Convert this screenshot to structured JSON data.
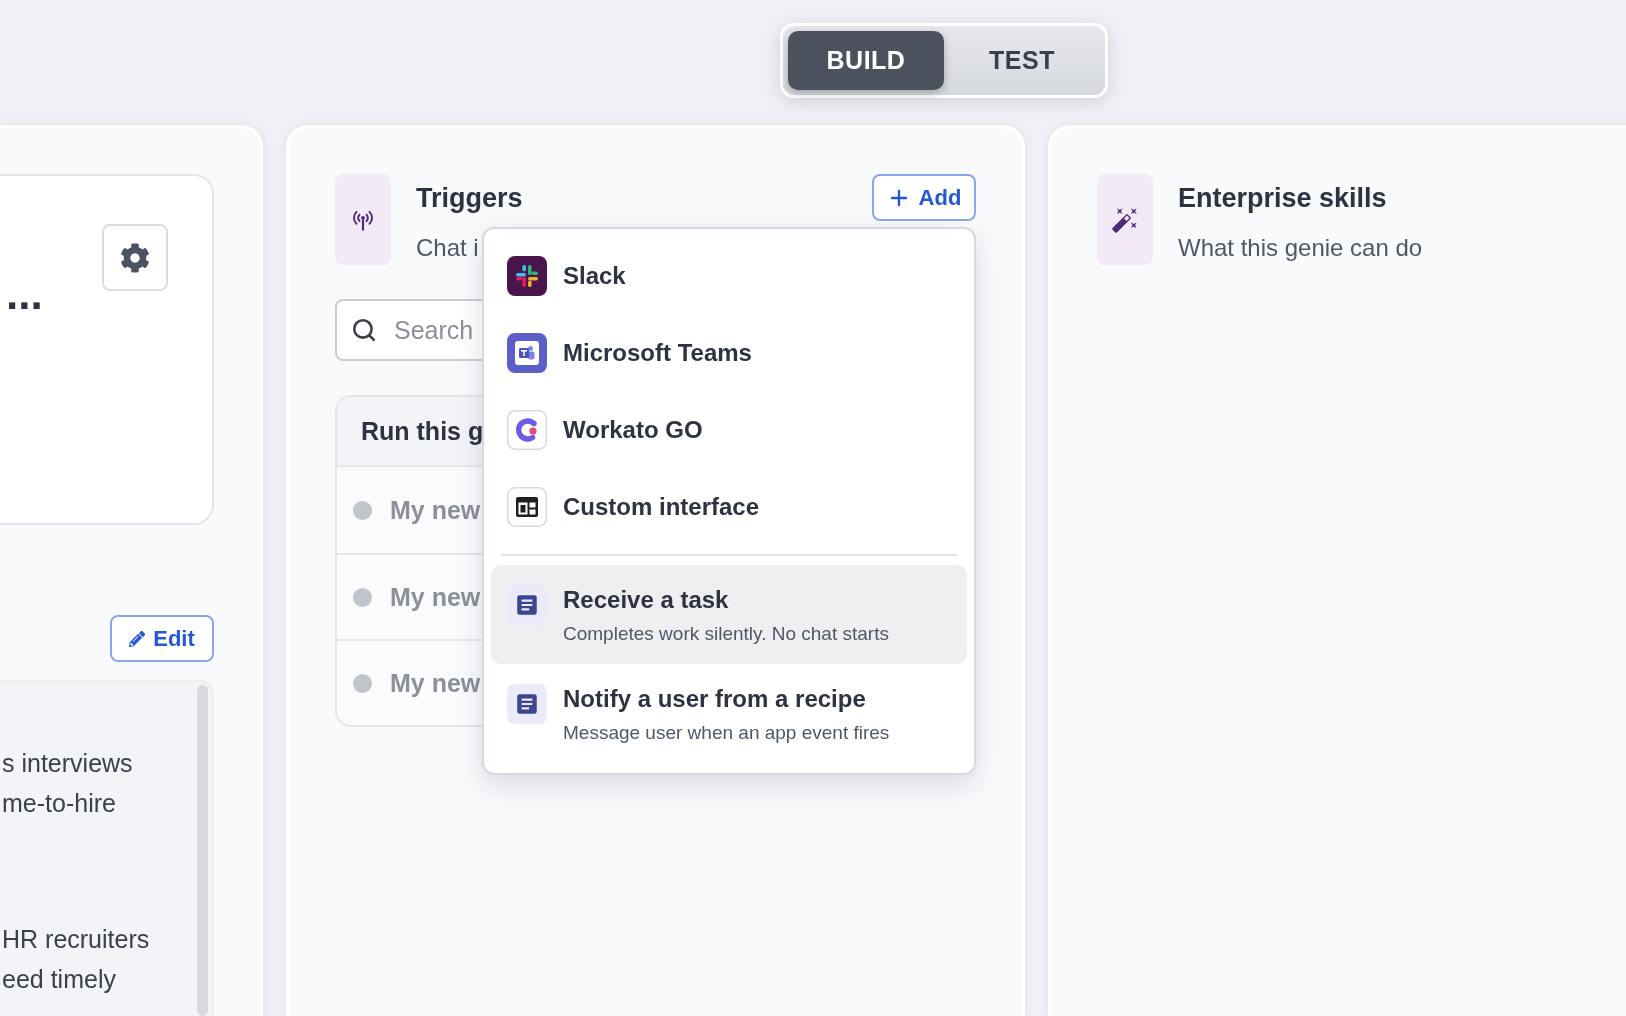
{
  "mode_toggle": [
    {
      "label": "BUILD",
      "selected": true
    },
    {
      "label": "TEST",
      "selected": false
    }
  ],
  "left_panel": {
    "title": "...",
    "edit_button": "Edit",
    "description": [
      {
        "lines": [
          "s interviews",
          "me-to-hire"
        ]
      },
      {
        "lines": [
          "HR recruiters",
          "eed timely"
        ]
      }
    ]
  },
  "triggers_panel": {
    "title": "Triggers",
    "subtitle": "Chat i",
    "add_button": "Add",
    "search": {
      "placeholder": "Search"
    },
    "run_card": {
      "title": "Run this g",
      "rows": [
        "My new",
        "My new",
        "My new"
      ]
    },
    "add_menu": {
      "items": [
        {
          "kind": "app",
          "label": "Slack",
          "selected": false
        },
        {
          "kind": "app",
          "label": "Microsoft Teams",
          "selected": false
        },
        {
          "kind": "app",
          "label": "Workato GO",
          "selected": false
        },
        {
          "kind": "app",
          "label": "Custom interface",
          "selected": false
        },
        {
          "kind": "action",
          "label": "Receive a task",
          "description": "Completes work silently. No chat starts",
          "selected": true
        },
        {
          "kind": "action",
          "label": "Notify a user from a recipe",
          "description": "Message user when an app event fires",
          "selected": false
        }
      ]
    }
  },
  "skills_panel": {
    "title": "Enterprise skills",
    "subtitle": "What this genie can do"
  }
}
